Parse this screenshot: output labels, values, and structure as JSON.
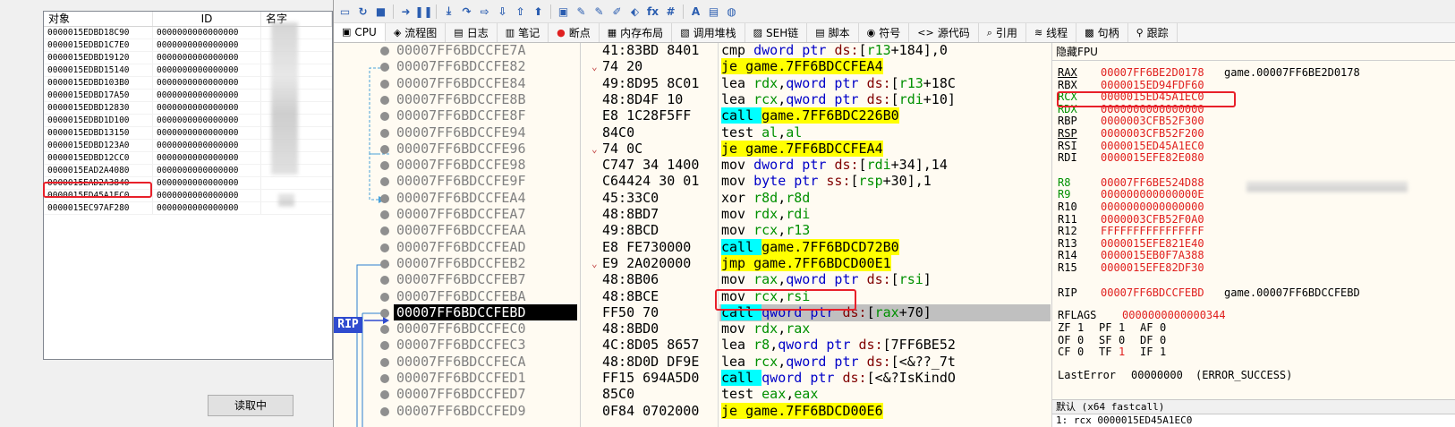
{
  "left_app": {
    "columns": [
      "对象",
      "ID",
      "名字"
    ],
    "rows": [
      {
        "obj": "0000015EDBD18C90",
        "id": "0000000000000000"
      },
      {
        "obj": "0000015EDBD1C7E0",
        "id": "0000000000000000"
      },
      {
        "obj": "0000015EDBD19120",
        "id": "0000000000000000"
      },
      {
        "obj": "0000015EDBD15140",
        "id": "0000000000000000"
      },
      {
        "obj": "0000015EDBD103B0",
        "id": "0000000000000000"
      },
      {
        "obj": "0000015EDBD17A50",
        "id": "0000000000000000"
      },
      {
        "obj": "0000015EDBD12830",
        "id": "0000000000000000"
      },
      {
        "obj": "0000015EDBD1D100",
        "id": "0000000000000000"
      },
      {
        "obj": "0000015EDBD13150",
        "id": "0000000000000000"
      },
      {
        "obj": "0000015EDBD123A0",
        "id": "0000000000000000"
      },
      {
        "obj": "0000015EDBD12CC0",
        "id": "0000000000000000"
      },
      {
        "obj": "0000015EAD2A4080",
        "id": "0000000000000000"
      },
      {
        "obj": "0000015EAD2A3840",
        "id": "0000000000000000"
      },
      {
        "obj": "0000015ED45A1EC0",
        "id": "0000000000000000"
      },
      {
        "obj": "0000015EC97AF280",
        "id": "0000000000000000"
      }
    ],
    "read_button": "读取中"
  },
  "debugger": {
    "toolbar_icons": [
      "open-icon",
      "restart-icon",
      "stop-icon",
      "run-icon",
      "pause-icon",
      "step-into-icon",
      "step-over-icon",
      "trace-into-icon",
      "trace-over-icon",
      "execute-till-return-icon",
      "run-to-user-code-icon",
      "patch-icon",
      "comment-icon",
      "label-icon",
      "bookmark-icon",
      "function-icon",
      "fx-icon",
      "hash-icon",
      "font-icon",
      "calculator-icon",
      "globe-icon"
    ],
    "toolbar_glyphs": [
      "▭",
      "↻",
      "■",
      "➜",
      "❚❚",
      "⤓",
      "↷",
      "⇨",
      "⇩",
      "⇧",
      "⬆",
      "▣",
      "✎",
      "✎",
      "✐",
      "⬖",
      "fx",
      "#",
      "A",
      "▤",
      "◍"
    ],
    "tabs": [
      {
        "label": "CPU",
        "icon": "cpu-icon",
        "glyph": "▣"
      },
      {
        "label": "流程图",
        "icon": "graph-icon",
        "glyph": "◈"
      },
      {
        "label": "日志",
        "icon": "log-icon",
        "glyph": "▤"
      },
      {
        "label": "笔记",
        "icon": "notes-icon",
        "glyph": "▥"
      },
      {
        "label": "断点",
        "icon": "breakpoint-icon",
        "glyph": "●"
      },
      {
        "label": "内存布局",
        "icon": "memory-map-icon",
        "glyph": "▦"
      },
      {
        "label": "调用堆栈",
        "icon": "call-stack-icon",
        "glyph": "▧"
      },
      {
        "label": "SEH链",
        "icon": "seh-icon",
        "glyph": "▨"
      },
      {
        "label": "脚本",
        "icon": "script-icon",
        "glyph": "▤"
      },
      {
        "label": "符号",
        "icon": "symbols-icon",
        "glyph": "◉"
      },
      {
        "label": "源代码",
        "icon": "source-icon",
        "glyph": "<>"
      },
      {
        "label": "引用",
        "icon": "references-icon",
        "glyph": "⌕"
      },
      {
        "label": "线程",
        "icon": "threads-icon",
        "glyph": "≋"
      },
      {
        "label": "句柄",
        "icon": "handles-icon",
        "glyph": "▩"
      },
      {
        "label": "跟踪",
        "icon": "trace-icon",
        "glyph": "⚲"
      }
    ],
    "rip_label": "RIP",
    "disasm": [
      {
        "addr": "00007FF6BDCCFE7A",
        "bytes": "41:83BD 8401",
        "parts": [
          [
            "mn",
            "cmp "
          ],
          [
            "mem",
            "dword ptr "
          ],
          [
            "sg",
            "ds:"
          ],
          [
            "bracket",
            "["
          ],
          [
            "rg",
            "r13"
          ],
          [
            "mn",
            "+184],0"
          ]
        ]
      },
      {
        "addr": "00007FF6BDCCFE82",
        "mark": "⌄",
        "bytes": "74 20",
        "hl": "y",
        "parts": [
          [
            "mn",
            "je "
          ],
          [
            "mn",
            "game.7FF6BDCCFEA4"
          ]
        ]
      },
      {
        "addr": "00007FF6BDCCFE84",
        "bytes": "49:8D95 8C01",
        "parts": [
          [
            "mn",
            "lea "
          ],
          [
            "rg",
            "rdx"
          ],
          [
            "mn",
            ","
          ],
          [
            "mem",
            "qword ptr "
          ],
          [
            "sg",
            "ds:"
          ],
          [
            "bracket",
            "["
          ],
          [
            "rg",
            "r13"
          ],
          [
            "mn",
            "+18C"
          ]
        ]
      },
      {
        "addr": "00007FF6BDCCFE8B",
        "bytes": "48:8D4F 10",
        "parts": [
          [
            "mn",
            "lea "
          ],
          [
            "rg",
            "rcx"
          ],
          [
            "mn",
            ","
          ],
          [
            "mem",
            "qword ptr "
          ],
          [
            "sg",
            "ds:"
          ],
          [
            "bracket",
            "["
          ],
          [
            "rg",
            "rdi"
          ],
          [
            "mn",
            "+10]"
          ]
        ]
      },
      {
        "addr": "00007FF6BDCCFE8F",
        "bytes": "E8 1C28F5FF",
        "hl": "c",
        "parts": [
          [
            "mn",
            "call "
          ],
          [
            "mn",
            "game.7FF6BDC226B0"
          ]
        ]
      },
      {
        "addr": "00007FF6BDCCFE94",
        "bytes": "84C0",
        "parts": [
          [
            "mn",
            "test "
          ],
          [
            "rg",
            "al"
          ],
          [
            "mn",
            ","
          ],
          [
            "rg",
            "al"
          ]
        ]
      },
      {
        "addr": "00007FF6BDCCFE96",
        "mark": "⌄",
        "bytes": "74 0C",
        "hl": "y",
        "parts": [
          [
            "mn",
            "je "
          ],
          [
            "mn",
            "game.7FF6BDCCFEA4"
          ]
        ]
      },
      {
        "addr": "00007FF6BDCCFE98",
        "bytes": "C747 34 1400",
        "parts": [
          [
            "mn",
            "mov "
          ],
          [
            "mem",
            "dword ptr "
          ],
          [
            "sg",
            "ds:"
          ],
          [
            "bracket",
            "["
          ],
          [
            "rg",
            "rdi"
          ],
          [
            "mn",
            "+34],14"
          ]
        ]
      },
      {
        "addr": "00007FF6BDCCFE9F",
        "bytes": "C64424 30 01",
        "parts": [
          [
            "mn",
            "mov "
          ],
          [
            "mem",
            "byte ptr "
          ],
          [
            "sg",
            "ss:"
          ],
          [
            "bracket",
            "["
          ],
          [
            "rg",
            "rsp"
          ],
          [
            "mn",
            "+30],1"
          ]
        ]
      },
      {
        "addr": "00007FF6BDCCFEA4",
        "bytes": "45:33C0",
        "parts": [
          [
            "mn",
            "xor "
          ],
          [
            "rg",
            "r8d"
          ],
          [
            "mn",
            ","
          ],
          [
            "rg",
            "r8d"
          ]
        ]
      },
      {
        "addr": "00007FF6BDCCFEA7",
        "bytes": "48:8BD7",
        "parts": [
          [
            "mn",
            "mov "
          ],
          [
            "rg",
            "rdx"
          ],
          [
            "mn",
            ","
          ],
          [
            "rg",
            "rdi"
          ]
        ]
      },
      {
        "addr": "00007FF6BDCCFEAA",
        "bytes": "49:8BCD",
        "parts": [
          [
            "mn",
            "mov "
          ],
          [
            "rg",
            "rcx"
          ],
          [
            "mn",
            ","
          ],
          [
            "rg",
            "r13"
          ]
        ]
      },
      {
        "addr": "00007FF6BDCCFEAD",
        "bytes": "E8 FE730000",
        "hl": "c",
        "parts": [
          [
            "mn",
            "call "
          ],
          [
            "mn",
            "game.7FF6BDCD72B0"
          ]
        ]
      },
      {
        "addr": "00007FF6BDCCFEB2",
        "mark": "⌄",
        "bytes": "E9 2A020000",
        "hl": "y",
        "parts": [
          [
            "mn",
            "jmp "
          ],
          [
            "mn",
            "game.7FF6BDCD00E1"
          ]
        ]
      },
      {
        "addr": "00007FF6BDCCFEB7",
        "bytes": "48:8B06",
        "parts": [
          [
            "mn",
            "mov "
          ],
          [
            "rg",
            "rax"
          ],
          [
            "mn",
            ","
          ],
          [
            "mem",
            "qword ptr "
          ],
          [
            "sg",
            "ds:"
          ],
          [
            "bracket",
            "["
          ],
          [
            "rg",
            "rsi"
          ],
          [
            "mn",
            "]"
          ]
        ]
      },
      {
        "addr": "00007FF6BDCCFEBA",
        "bytes": "48:8BCE",
        "parts": [
          [
            "mn",
            "mov "
          ],
          [
            "rg",
            "rcx"
          ],
          [
            "mn",
            ","
          ],
          [
            "rg",
            "rsi"
          ]
        ]
      },
      {
        "addr": "00007FF6BDCCFEBD",
        "rip": true,
        "bytes": "FF50 70",
        "hl": "c",
        "parts": [
          [
            "mn",
            "call "
          ],
          [
            "mem",
            "qword ptr "
          ],
          [
            "sg",
            "ds:"
          ],
          [
            "bracket",
            "["
          ],
          [
            "rg",
            "rax"
          ],
          [
            "mn",
            "+70]"
          ]
        ]
      },
      {
        "addr": "00007FF6BDCCFEC0",
        "bytes": "48:8BD0",
        "parts": [
          [
            "mn",
            "mov "
          ],
          [
            "rg",
            "rdx"
          ],
          [
            "mn",
            ","
          ],
          [
            "rg",
            "rax"
          ]
        ]
      },
      {
        "addr": "00007FF6BDCCFEC3",
        "bytes": "4C:8D05 8657",
        "parts": [
          [
            "mn",
            "lea "
          ],
          [
            "rg",
            "r8"
          ],
          [
            "mn",
            ","
          ],
          [
            "mem",
            "qword ptr "
          ],
          [
            "sg",
            "ds:"
          ],
          [
            "bracket",
            "["
          ],
          [
            "mn",
            "7FF6BE52"
          ]
        ]
      },
      {
        "addr": "00007FF6BDCCFECA",
        "bytes": "48:8D0D DF9E",
        "parts": [
          [
            "mn",
            "lea "
          ],
          [
            "rg",
            "rcx"
          ],
          [
            "mn",
            ","
          ],
          [
            "mem",
            "qword ptr "
          ],
          [
            "sg",
            "ds:"
          ],
          [
            "bracket",
            "["
          ],
          [
            "mn",
            "<&??_7t"
          ]
        ]
      },
      {
        "addr": "00007FF6BDCCFED1",
        "bytes": "FF15 694A5D0",
        "hl": "c",
        "parts": [
          [
            "mn",
            "call "
          ],
          [
            "mem",
            "qword ptr "
          ],
          [
            "sg",
            "ds:"
          ],
          [
            "bracket",
            "["
          ],
          [
            "mn",
            "<&?IsKindO"
          ]
        ]
      },
      {
        "addr": "00007FF6BDCCFED7",
        "bytes": "85C0",
        "parts": [
          [
            "mn",
            "test "
          ],
          [
            "rg",
            "eax"
          ],
          [
            "mn",
            ","
          ],
          [
            "rg",
            "eax"
          ]
        ]
      },
      {
        "addr": "00007FF6BDCCFED9",
        "bytes": "0F84 0702000",
        "hl": "y",
        "parts": [
          [
            "mn",
            "je "
          ],
          [
            "mn",
            "game.7FF6BDCD00E6"
          ]
        ]
      }
    ],
    "registers": {
      "header": "隐藏FPU",
      "general": [
        {
          "name": "RAX",
          "value": "00007FF6BE2D0178",
          "comment": "game.00007FF6BE2D0178",
          "underline": true
        },
        {
          "name": "RBX",
          "value": "0000015ED94FDF60",
          "comment": ""
        },
        {
          "name": "RCX",
          "value": "0000015ED45A1EC0",
          "comment": "",
          "changed": true
        },
        {
          "name": "RDX",
          "value": "0000000000000000",
          "comment": "",
          "changed": true
        },
        {
          "name": "RBP",
          "value": "0000003CFB52F300",
          "comment": ""
        },
        {
          "name": "RSP",
          "value": "0000003CFB52F200",
          "comment": "",
          "underline": true
        },
        {
          "name": "RSI",
          "value": "0000015ED45A1EC0",
          "comment": ""
        },
        {
          "name": "RDI",
          "value": "0000015EFE82E080",
          "comment": ""
        }
      ],
      "extended": [
        {
          "name": "R8",
          "value": "00007FF6BE524D88",
          "comment": "",
          "changed": true
        },
        {
          "name": "R9",
          "value": "000000000000000E",
          "comment": "",
          "changed": true
        },
        {
          "name": "R10",
          "value": "0000000000000000",
          "comment": ""
        },
        {
          "name": "R11",
          "value": "0000003CFB52F0A0",
          "comment": ""
        },
        {
          "name": "R12",
          "value": "FFFFFFFFFFFFFFFF",
          "comment": ""
        },
        {
          "name": "R13",
          "value": "0000015EFE821E40",
          "comment": ""
        },
        {
          "name": "R14",
          "value": "0000015EB0F7A388",
          "comment": ""
        },
        {
          "name": "R15",
          "value": "0000015EFE82DF30",
          "comment": ""
        }
      ],
      "rip": {
        "name": "RIP",
        "value": "00007FF6BDCCFEBD",
        "comment": "game.00007FF6BDCCFEBD"
      },
      "rflags": {
        "name": "RFLAGS",
        "value": "0000000000000344"
      },
      "flags": [
        [
          [
            "ZF",
            "1"
          ],
          [
            "PF",
            "1"
          ],
          [
            "AF",
            "0"
          ]
        ],
        [
          [
            "OF",
            "0"
          ],
          [
            "SF",
            "0"
          ],
          [
            "DF",
            "0"
          ]
        ],
        [
          [
            "CF",
            "0"
          ],
          [
            "TF",
            "1"
          ],
          [
            "IF",
            "1"
          ]
        ]
      ],
      "last_error": {
        "name": "LastError",
        "value": "00000000",
        "comment": "(ERROR_SUCCESS)"
      }
    },
    "call_convention": "默认 (x64 fastcall)",
    "arg1": "1: rcx 0000015ED45A1EC0"
  },
  "colors": {
    "highlight_red": "#e8202a",
    "reg_value": "#e0201e",
    "rip_badge": "#2f4bcf",
    "jump_hl": "#ffff00",
    "call_hl": "#00ffff"
  }
}
